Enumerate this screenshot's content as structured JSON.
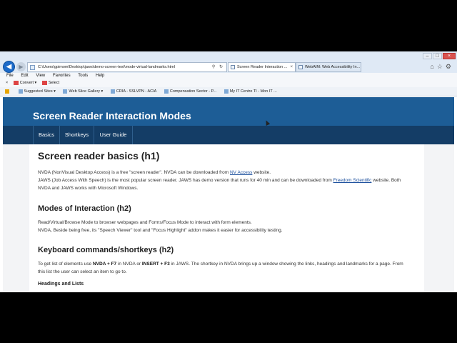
{
  "browser": {
    "address": "C:\\Users\\gpimom\\Desktop\\jaws\\demo-screen-text\\mode-virtual-landmarks.html",
    "tabs": [
      {
        "label": "Screen Reader Interaction ..."
      },
      {
        "label": "WebAIM: Web Accessibility In..."
      }
    ],
    "menu": [
      "File",
      "Edit",
      "View",
      "Favorites",
      "Tools",
      "Help"
    ],
    "commands": [
      "Convert",
      "Select"
    ],
    "favorites": [
      "Suggested Sites",
      "Web Slice Gallery",
      "CRIA - SSLVPN - ACIA",
      "Compensation Sector - P...",
      "My IT Centre TI - Mon IT ..."
    ]
  },
  "site": {
    "title": "Screen Reader Interaction Modes",
    "nav": [
      "Basics",
      "Shortkeys",
      "User Guide"
    ]
  },
  "content": {
    "h1": "Screen reader basics (h1)",
    "p1a": "NVDA (NonVisual Desktop Access) is a free \"screen reader\". NVDA can be downloaded from ",
    "p1link": "NV Access",
    "p1b": " website.",
    "p2a": "JAWS (Job Access With Speech) is the most popular screen reader. JAWS has demo version that runs for 40 min and can be downloaded from ",
    "p2link": "Freedom Scientific",
    "p2b": " website. Both NVDA and JAWS works with Microsoft Windows.",
    "h2a": "Modes of Interaction (h2)",
    "p3": "Read/Virtual/Browse Mode to browser webpages and Forms/Focus Mode to interact with form elements.",
    "p4": "NVDA, Beside being free, its \"Speech Viewer\" tool and \"Focus Highlight\" addon makes it easier for accessibility testing.",
    "h2b": "Keyboard commands/shortkeys (h2)",
    "p5a": "To get list of elements use ",
    "p5k1": "NVDA + F7",
    "p5b": " in NVDA or ",
    "p5k2": "INSERT + F3",
    "p5c": " in JAWS. The shortkey in NVDA brings up a window showing the links, headings and landmarks for a page. From this list the user can select an item to go to.",
    "h4": "Headings and Lists"
  }
}
